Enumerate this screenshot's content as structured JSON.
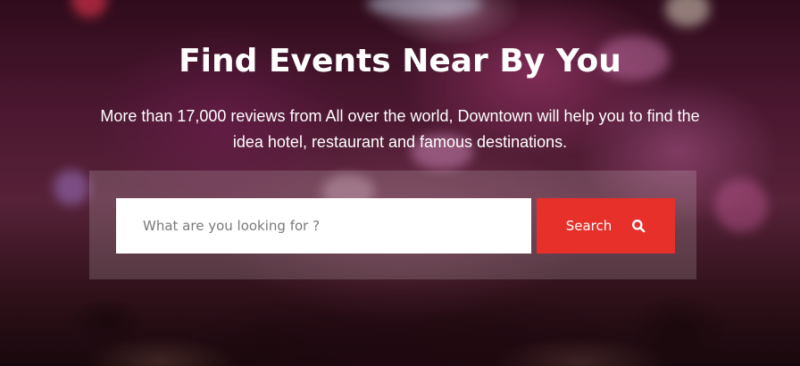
{
  "hero": {
    "title": "Find Events Near By You",
    "subtitle_line1": "More than 17,000 reviews from All over the world, Downtown will help you to find the",
    "subtitle_line2": "idea hotel, restaurant and famous destinations."
  },
  "search": {
    "placeholder": "What are you looking for ?",
    "value": "",
    "button_label": "Search",
    "button_icon": "search-icon",
    "button_color": "#e8302b"
  }
}
